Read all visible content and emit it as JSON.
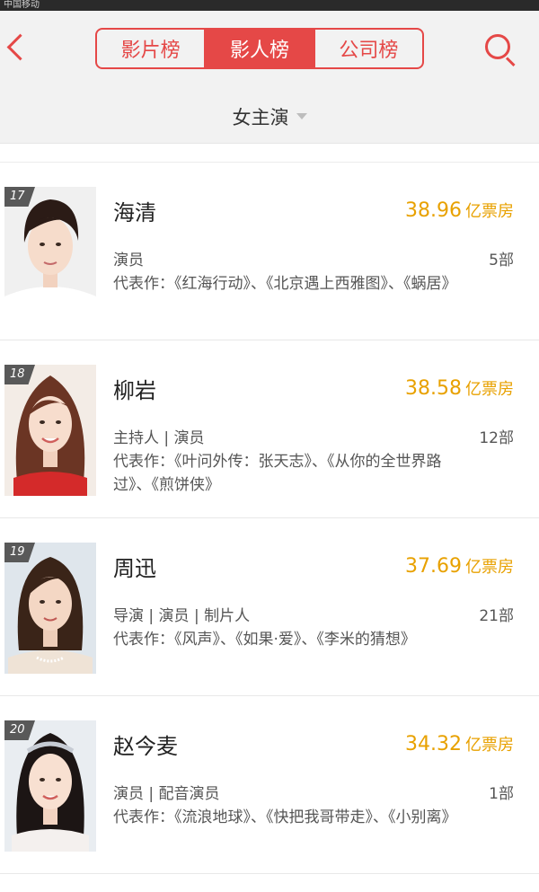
{
  "status_bar": {
    "carrier": "中国移动"
  },
  "header": {
    "tabs": [
      {
        "label": "影片榜",
        "active": false
      },
      {
        "label": "影人榜",
        "active": true
      },
      {
        "label": "公司榜",
        "active": false
      }
    ]
  },
  "filter": {
    "label": "女主演"
  },
  "colors": {
    "accent": "#e54847",
    "box_office": "#e8a100"
  },
  "rows": [
    {
      "rank": "17",
      "name": "海清",
      "box_value": "38.96",
      "box_unit": "亿票房",
      "roles": "演员",
      "count": "5部",
      "works": "代表作：《红海行动》、《北京遇上西雅图》、《蜗居》",
      "hair": "#2b1b16",
      "top": "#ffffff",
      "bg": "#f0f0f0"
    },
    {
      "rank": "18",
      "name": "柳岩",
      "box_value": "38.58",
      "box_unit": "亿票房",
      "roles": "主持人 | 演员",
      "count": "12部",
      "works": "代表作：《叶问外传：张天志》、《从你的全世界路过》、《煎饼侠》",
      "hair": "#6b3524",
      "top": "#d42a2a",
      "bg": "#f3ece6"
    },
    {
      "rank": "19",
      "name": "周迅",
      "box_value": "37.69",
      "box_unit": "亿票房",
      "roles": "导演 | 演员 | 制片人",
      "count": "21部",
      "works": "代表作：《风声》、《如果·爱》、《李米的猜想》",
      "hair": "#3a2418",
      "top": "#efe3d6",
      "bg": "#dfe6ec"
    },
    {
      "rank": "20",
      "name": "赵今麦",
      "box_value": "34.32",
      "box_unit": "亿票房",
      "roles": "演员 | 配音演员",
      "count": "1部",
      "works": "代表作：《流浪地球》、《快把我哥带走》、《小别离》",
      "hair": "#1c1514",
      "top": "#f4f0ee",
      "bg": "#e9edf1"
    }
  ]
}
